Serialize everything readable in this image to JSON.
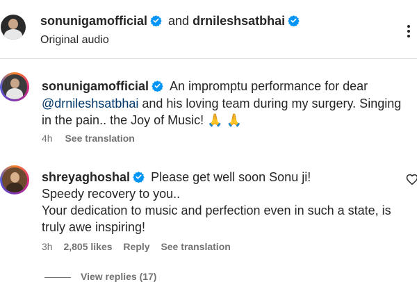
{
  "header": {
    "user1": "sonunigamofficial",
    "conj": "and",
    "user2": "drnileshsatbhai",
    "subtitle": "Original audio"
  },
  "caption": {
    "username": "sonunigamofficial",
    "line1": "An impromptu performance for dear",
    "mention": "@drnileshsatbhai",
    "line2_rest": "and his loving team during my surgery. Singing",
    "line3": "in the pain.. the Joy of Music! 🙏 🙏",
    "time": "4h",
    "see_translation": "See translation"
  },
  "comment": {
    "username": "shreyaghoshal",
    "line1": "Please get well soon Sonu ji!",
    "line2": "Speedy recovery to you..",
    "line3": "Your dedication to music and perfection even in such a state, is",
    "line4": "truly awe inspiring!",
    "time": "3h",
    "likes": "2,805 likes",
    "reply": "Reply",
    "see_translation": "See translation",
    "view_replies": "View replies (17)"
  },
  "colors": {
    "verified": "#0095f6",
    "mention": "#00376b",
    "meta": "#737373"
  },
  "icons": [
    "verified-badge-icon",
    "more-options-icon",
    "heart-icon",
    "folded-hands-emoji"
  ]
}
